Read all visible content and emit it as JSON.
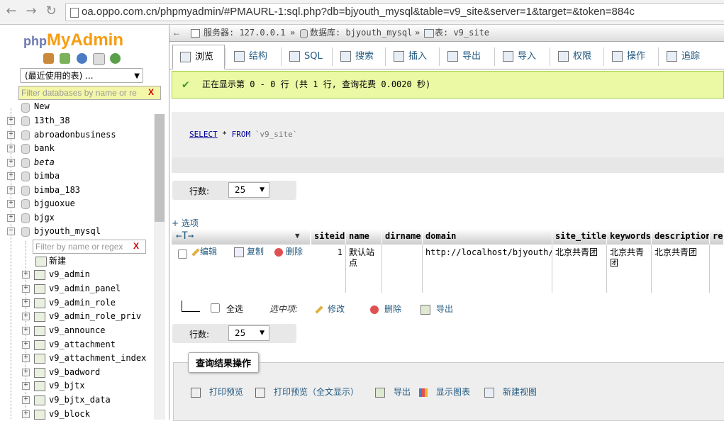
{
  "browser": {
    "url": "oa.oppo.com.cn/phpmyadmin/#PMAURL-1:sql.php?db=bjyouth_mysql&table=v9_site&server=1&target=&token=884c"
  },
  "sidebar": {
    "logo_php": "php",
    "logo_myadmin": "MyAdmin",
    "recent_label": "(最近使用的表) ...",
    "db_filter_placeholder": "Filter databases by name or re",
    "table_filter_placeholder": "Filter by name or regex",
    "clear": "X",
    "new_label": "New",
    "databases": [
      "13th_38",
      "abroadonbusiness",
      "bank",
      "beta",
      "bimba",
      "bimba_183",
      "bjguoxue",
      "bjgx",
      "bjyouth_mysql"
    ],
    "new_table_label": "新建",
    "tables": [
      "v9_admin",
      "v9_admin_panel",
      "v9_admin_role",
      "v9_admin_role_priv",
      "v9_announce",
      "v9_attachment",
      "v9_attachment_index",
      "v9_badword",
      "v9_bjtx",
      "v9_bjtx_data",
      "v9_block"
    ]
  },
  "breadcrumb": {
    "server_label": "服务器: 127.0.0.1",
    "db_label": "数据库: bjyouth_mysql",
    "table_label": "表: v9_site",
    "sep": "»"
  },
  "tabs": [
    "浏览",
    "结构",
    "SQL",
    "搜索",
    "插入",
    "导出",
    "导入",
    "权限",
    "操作",
    "追踪"
  ],
  "success_message": "正在显示第 0 - 0 行 (共 1 行, 查询花费 0.0020 秒)",
  "sql": {
    "select": "SELECT",
    "star": " * ",
    "from": "FROM",
    "table": " `v9_site`"
  },
  "rows_label": "行数:",
  "rows_value": "25",
  "options_label": "+ 选项",
  "columns": [
    "siteid",
    "name",
    "dirname",
    "domain",
    "site_title",
    "keywords",
    "description",
    "re"
  ],
  "row": {
    "edit": "编辑",
    "copy": "复制",
    "delete": "删除",
    "siteid": "1",
    "name": "默认站点",
    "dirname": "",
    "domain": "http://localhost/bjyouth/",
    "site_title": "北京共青团",
    "keywords": "北京共青团",
    "description": "北京共青团"
  },
  "bulk": {
    "select_all": "全选",
    "with_selected": "选中项:",
    "change": "修改",
    "delete": "删除",
    "export": "导出"
  },
  "query_results": {
    "title": "查询结果操作",
    "print": "打印预览",
    "print_full": "打印预览（全文显示）",
    "export": "导出",
    "chart": "显示图表",
    "view": "新建视图"
  }
}
